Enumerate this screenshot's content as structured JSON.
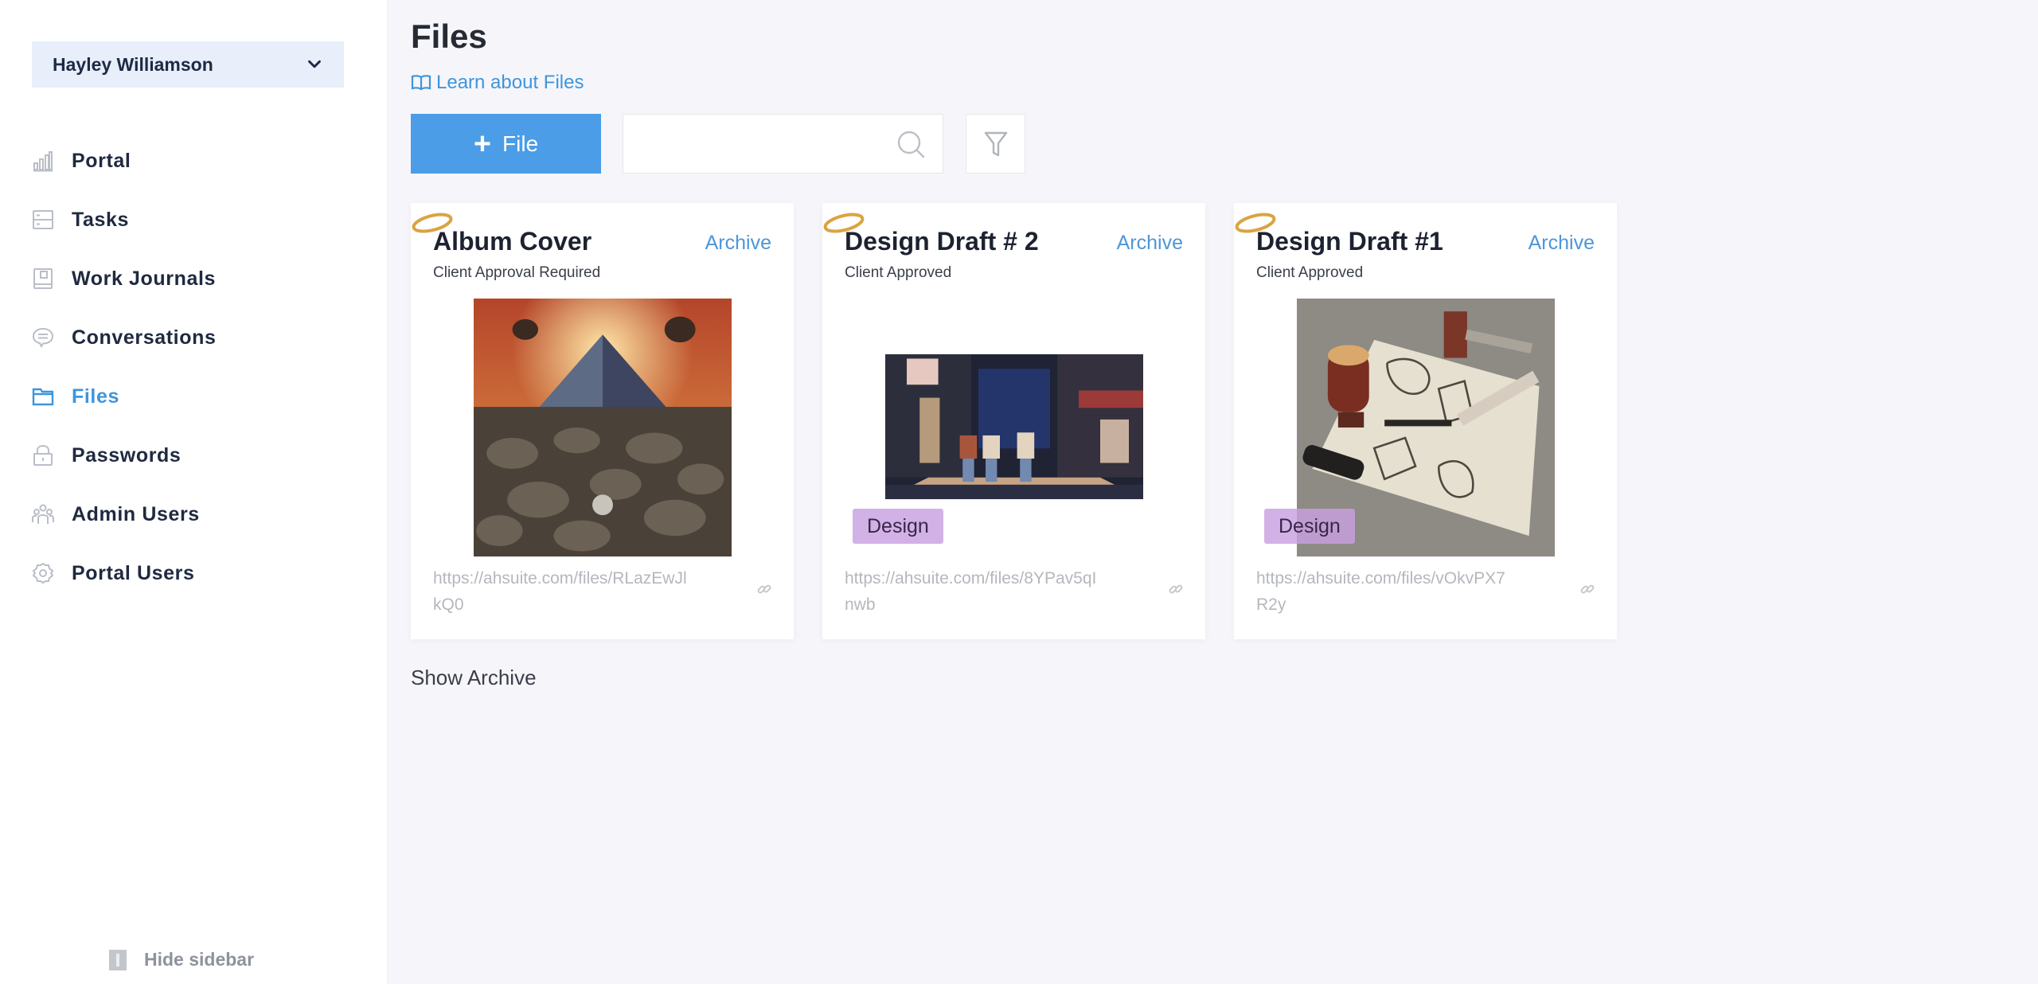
{
  "sidebar": {
    "user_name": "Hayley Williamson",
    "items": [
      {
        "label": "Portal",
        "icon": "bar-chart-icon",
        "active": false
      },
      {
        "label": "Tasks",
        "icon": "tasks-icon",
        "active": false
      },
      {
        "label": "Work Journals",
        "icon": "journal-icon",
        "active": false
      },
      {
        "label": "Conversations",
        "icon": "chat-bubble-icon",
        "active": false
      },
      {
        "label": "Files",
        "icon": "folder-icon",
        "active": true
      },
      {
        "label": "Passwords",
        "icon": "lock-icon",
        "active": false
      },
      {
        "label": "Admin Users",
        "icon": "users-icon",
        "active": false
      },
      {
        "label": "Portal Users",
        "icon": "gear-icon",
        "active": false
      }
    ],
    "hide_label": "Hide sidebar"
  },
  "header": {
    "title": "Files",
    "learn_link": "Learn about Files"
  },
  "toolbar": {
    "add_file_label": "File",
    "search_value": "",
    "search_placeholder": ""
  },
  "files": [
    {
      "title": "Album Cover",
      "archive_label": "Archive",
      "status": "Client Approval Required",
      "image": "album-cover-pyramid-image",
      "tag": null,
      "url": "https://ahsuite.com/files/RLazEwJlkQ0"
    },
    {
      "title": "Design Draft # 2",
      "archive_label": "Archive",
      "status": "Client Approved",
      "image": "night-street-image",
      "tag": "Design",
      "url": "https://ahsuite.com/files/8YPav5qInwb"
    },
    {
      "title": "Design Draft #1",
      "archive_label": "Archive",
      "status": "Client Approved",
      "image": "sketch-desk-image",
      "tag": "Design",
      "url": "https://ahsuite.com/files/vOkvPX7R2y"
    }
  ],
  "show_archive_label": "Show Archive",
  "colors": {
    "accent": "#4a9de6",
    "active_nav": "#3e95dc",
    "tag_bg": "#c8a0e1",
    "ring": "#d9a441"
  }
}
